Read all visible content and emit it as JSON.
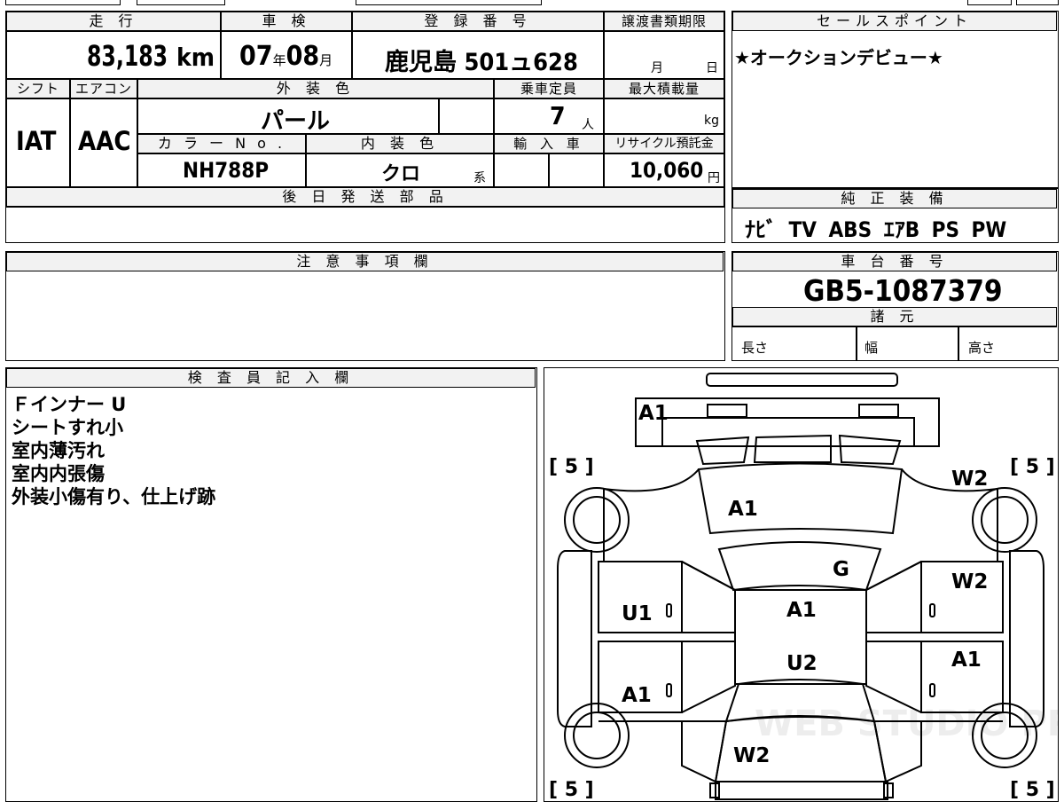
{
  "top": {
    "headers": {
      "mileage": "走 行",
      "inspection": "車 検",
      "registration": "登 録 番 号",
      "transfer_deadline": "譲渡書類期限",
      "sales_point": "セールスポイント"
    },
    "mileage_value": "83,183",
    "mileage_unit": "km",
    "inspection_year": "07",
    "inspection_year_unit": "年",
    "inspection_month": "08",
    "inspection_month_unit": "月",
    "registration_number": "鹿児島 501ュ628",
    "deadline_month_unit": "月",
    "deadline_day_unit": "日"
  },
  "spec": {
    "headers": {
      "shift": "シフト",
      "aircon": "エアコン",
      "exterior_color": "外 装 色",
      "seating": "乗車定員",
      "max_load": "最大積載量",
      "color_no": "カ ラ ー N o .",
      "interior_color": "内 装 色",
      "import": "輸 入 車",
      "recycle": "リサイクル預託金"
    },
    "shift": "IAT",
    "aircon": "AAC",
    "exterior_color": "パール",
    "seating": "7",
    "seating_unit": "人",
    "max_load_unit": "kg",
    "color_no": "NH788P",
    "interior_color": "クロ",
    "interior_suffix": "系",
    "recycle_fee": "10,060",
    "recycle_unit": "円"
  },
  "sales_point": {
    "text": "★オークションデビュー★"
  },
  "later_parts": {
    "header": "後 日 発 送 部 品"
  },
  "genuine_equipment": {
    "header": "純 正 装 備",
    "items": "ﾅﾋﾞ TV ABS ｴｱB PS PW"
  },
  "caution": {
    "header": "注 意 事 項 欄"
  },
  "chassis": {
    "header": "車 台 番 号",
    "number": "GB5-1087379",
    "specs_header": "諸 元",
    "length_label": "長さ",
    "width_label": "幅",
    "height_label": "高さ"
  },
  "inspector": {
    "header": "検 査 員 記 入 欄",
    "notes": [
      "Ｆインナー U",
      "シートすれ小",
      "室内薄汚れ",
      "室内内張傷",
      "外装小傷有り、仕上げ跡"
    ]
  },
  "diagram": {
    "marks": {
      "front_bumper": "A1",
      "hood": "A1",
      "windshield": "G",
      "roof_front": "A1",
      "roof_rear": "U2",
      "left_front_door": "U1",
      "left_rear_door": "A1",
      "right_fender": "W2",
      "right_front_door": "W2",
      "right_rear_door": "A1",
      "rear": "W2"
    },
    "tire_marks": [
      "[ 5 ]",
      "[ 5 ]",
      "[ 5 ]",
      "[ 5 ]"
    ],
    "watermark": "WEB STUDIO PRO"
  }
}
